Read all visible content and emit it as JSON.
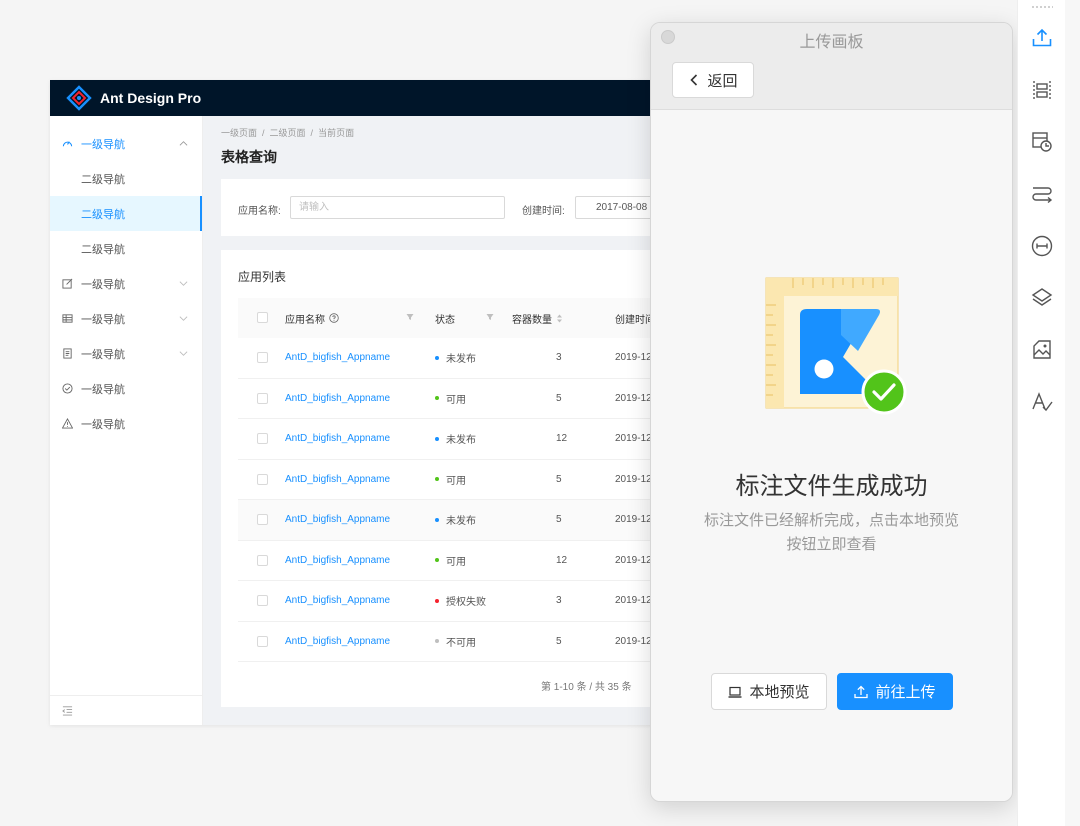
{
  "app": {
    "name": "Ant Design Pro",
    "menu": [
      {
        "label": "一级导航",
        "icon": "dashboard-icon",
        "open": true
      },
      {
        "label": "二级导航",
        "sub": true
      },
      {
        "label": "二级导航",
        "sub": true,
        "selected": true
      },
      {
        "label": "二级导航",
        "sub": true
      },
      {
        "label": "一级导航",
        "icon": "edit-icon"
      },
      {
        "label": "一级导航",
        "icon": "table-icon"
      },
      {
        "label": "一级导航",
        "icon": "profile-icon"
      },
      {
        "label": "一级导航",
        "icon": "check-circle-icon"
      },
      {
        "label": "一级导航",
        "icon": "warning-icon"
      }
    ],
    "breadcrumb": [
      "一级页面",
      "二级页面",
      "当前页面"
    ],
    "page_title": "表格查询",
    "search": {
      "app_name_label": "应用名称:",
      "app_name_placeholder": "请输入",
      "created_label": "创建时间:",
      "created_value": "2017-08-08"
    },
    "table": {
      "card_title": "应用列表",
      "columns": [
        "应用名称",
        "状态",
        "容器数量",
        "创建时间"
      ],
      "rows": [
        {
          "name": "AntD_bigfish_Appname",
          "status": "未发布",
          "status_color": "#1890ff",
          "count": "3",
          "time": "2019-12"
        },
        {
          "name": "AntD_bigfish_Appname",
          "status": "可用",
          "status_color": "#52c41a",
          "count": "5",
          "time": "2019-12"
        },
        {
          "name": "AntD_bigfish_Appname",
          "status": "未发布",
          "status_color": "#1890ff",
          "count": "12",
          "time": "2019-12"
        },
        {
          "name": "AntD_bigfish_Appname",
          "status": "可用",
          "status_color": "#52c41a",
          "count": "5",
          "time": "2019-12"
        },
        {
          "name": "AntD_bigfish_Appname",
          "status": "未发布",
          "status_color": "#1890ff",
          "count": "5",
          "time": "2019-12"
        },
        {
          "name": "AntD_bigfish_Appname",
          "status": "可用",
          "status_color": "#52c41a",
          "count": "12",
          "time": "2019-12"
        },
        {
          "name": "AntD_bigfish_Appname",
          "status": "授权失败",
          "status_color": "#f5222d",
          "count": "3",
          "time": "2019-12"
        },
        {
          "name": "AntD_bigfish_Appname",
          "status": "不可用",
          "status_color": "#bfbfbf",
          "count": "5",
          "time": "2019-12"
        }
      ],
      "pagination": "第 1-10 条 / 共 35 条"
    }
  },
  "panel": {
    "title": "上传画板",
    "back_label": "返回",
    "success_title": "标注文件生成成功",
    "success_desc": "标注文件已经解析完成，点击本地预览按钮立即查看",
    "preview_label": "本地预览",
    "upload_label": "前往上传"
  },
  "toolbar": [
    "upload-icon",
    "slice-icon",
    "component-icon",
    "flow-icon",
    "measure-icon",
    "layers-icon",
    "assets-icon",
    "text-style-icon"
  ],
  "colors": {
    "primary": "#1890ff",
    "header_bg": "#001529",
    "success": "#52c41a"
  }
}
